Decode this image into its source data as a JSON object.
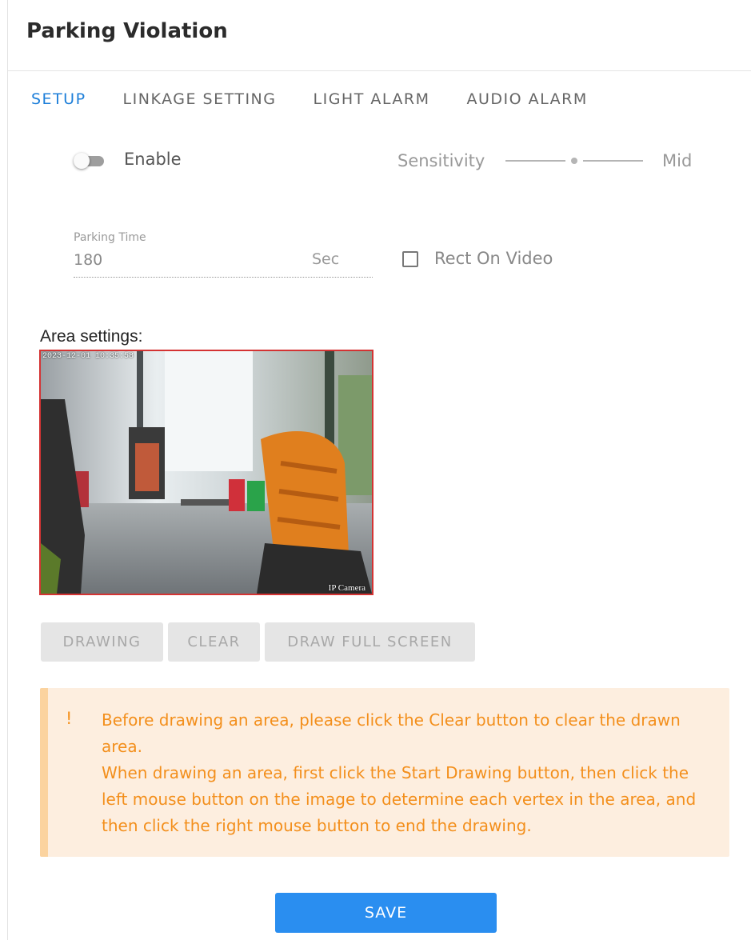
{
  "header": {
    "title": "Parking Violation"
  },
  "tabs": [
    {
      "label": "SETUP",
      "active": true
    },
    {
      "label": "LINKAGE SETTING",
      "active": false
    },
    {
      "label": "LIGHT ALARM",
      "active": false
    },
    {
      "label": "AUDIO ALARM",
      "active": false
    }
  ],
  "setup": {
    "enable": {
      "label": "Enable",
      "checked": false
    },
    "sensitivity": {
      "label": "Sensitivity",
      "value": "Mid",
      "level_fraction": 0.5
    },
    "parking_time": {
      "label": "Parking Time",
      "value": "180",
      "unit": "Sec"
    },
    "rect_on_video": {
      "label": "Rect On Video",
      "checked": false
    },
    "area_settings_label": "Area settings:",
    "camera": {
      "timestamp": "2023-12-01 10:35:58",
      "name": "IP Camera",
      "border_color": "#d43333"
    }
  },
  "area_buttons": {
    "drawing": "DRAWING",
    "clear": "CLEAR",
    "draw_full_screen": "DRAW FULL SCREEN"
  },
  "notice": {
    "icon": "!",
    "line1": "Before drawing an area, please click the Clear button to clear the drawn area.",
    "line2": "When drawing an area, first click the Start Drawing button, then click the left mouse button on the image to determine each vertex in the area, and then click the right mouse button to end the drawing."
  },
  "save_label": "SAVE",
  "colors": {
    "accent": "#1e7fd9",
    "save_button": "#2a8ef0",
    "notice_text": "#f38f1c",
    "notice_background": "#fdeedf",
    "notice_bar": "#fbd39f"
  }
}
